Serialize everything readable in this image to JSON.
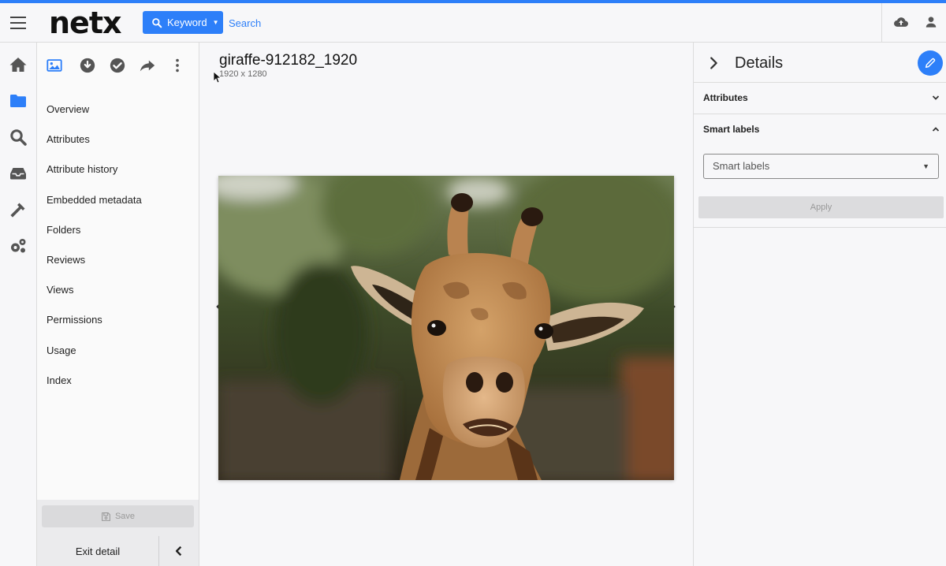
{
  "header": {
    "logo": "netx",
    "search_mode_label": "Keyword",
    "search_placeholder": "Search"
  },
  "asset": {
    "title": "giraffe-912182_1920",
    "dimensions": "1920 x 1280"
  },
  "side_nav": {
    "items": [
      {
        "label": "Overview"
      },
      {
        "label": "Attributes"
      },
      {
        "label": "Attribute history"
      },
      {
        "label": "Embedded metadata"
      },
      {
        "label": "Folders"
      },
      {
        "label": "Reviews"
      },
      {
        "label": "Views"
      },
      {
        "label": "Permissions"
      },
      {
        "label": "Usage"
      },
      {
        "label": "Index"
      }
    ],
    "save_label": "Save",
    "exit_label": "Exit detail"
  },
  "details": {
    "title": "Details",
    "sections": [
      {
        "label": "Attributes",
        "expanded": false
      },
      {
        "label": "Smart labels",
        "expanded": true
      }
    ],
    "smart_labels_placeholder": "Smart labels",
    "apply_label": "Apply"
  },
  "icons": {
    "left_rail": [
      "home-icon",
      "folder-icon",
      "search-icon",
      "inbox-icon",
      "hammer-icon",
      "gears-icon"
    ],
    "toolbar": [
      "image-icon",
      "download-icon",
      "check-circle-icon",
      "share-icon",
      "more-vertical-icon"
    ],
    "header_right": [
      "cloud-upload-icon",
      "user-icon"
    ]
  },
  "colors": {
    "accent": "#2d7ff9",
    "active_rail": "#2d7ff9"
  }
}
